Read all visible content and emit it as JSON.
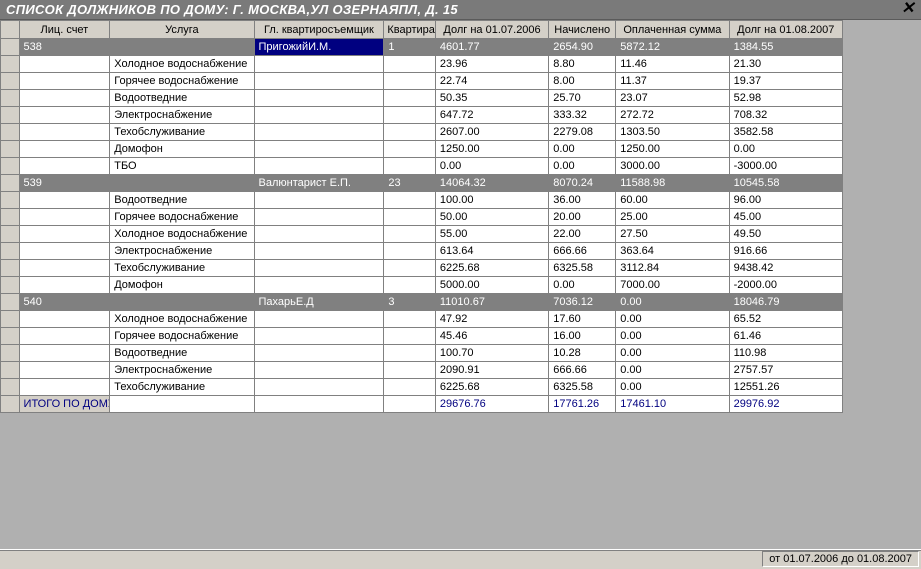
{
  "title": "СПИСОК ДОЛЖНИКОВ ПО ДОМУ: Г. МОСКВА,УЛ ОЗЕРНАЯПЛ, Д. 15",
  "close_glyph": "✕",
  "columns": {
    "acct": "Лиц. счет",
    "service": "Услуга",
    "tenant": "Гл. квартиросъемщик",
    "apt": "Квартира",
    "debt1": "Долг на 01.07.2006",
    "accrued": "Начислено",
    "paid": "Оплаченная сумма",
    "debt2": "Долг на 01.08.2007"
  },
  "rows": [
    {
      "type": "sum",
      "acct": "538",
      "service": "",
      "tenant": "ПригожийИ.М.",
      "tenant_selected": true,
      "apt": "1",
      "debt1": "4601.77",
      "accrued": "2654.90",
      "paid": "5872.12",
      "debt2": "1384.55"
    },
    {
      "type": "svc",
      "service": "Холодное водоснабжение",
      "debt1": "23.96",
      "accrued": "8.80",
      "paid": "11.46",
      "debt2": "21.30"
    },
    {
      "type": "svc",
      "service": "Горячее водоснабжение",
      "debt1": "22.74",
      "accrued": "8.00",
      "paid": "11.37",
      "debt2": "19.37"
    },
    {
      "type": "svc",
      "service": "Водоотведние",
      "debt1": "50.35",
      "accrued": "25.70",
      "paid": "23.07",
      "debt2": "52.98"
    },
    {
      "type": "svc",
      "service": "Электроснабжение",
      "debt1": "647.72",
      "accrued": "333.32",
      "paid": "272.72",
      "debt2": "708.32"
    },
    {
      "type": "svc",
      "service": "Техобслуживание",
      "debt1": "2607.00",
      "accrued": "2279.08",
      "paid": "1303.50",
      "debt2": "3582.58"
    },
    {
      "type": "svc",
      "service": "Домофон",
      "debt1": "1250.00",
      "accrued": "0.00",
      "paid": "1250.00",
      "debt2": "0.00"
    },
    {
      "type": "svc",
      "service": "ТБО",
      "debt1": "0.00",
      "accrued": "0.00",
      "paid": "3000.00",
      "debt2": "-3000.00"
    },
    {
      "type": "sum",
      "acct": "539",
      "service": "",
      "tenant": "Валюнтарист Е.П.",
      "apt": "23",
      "debt1": "14064.32",
      "accrued": "8070.24",
      "paid": "11588.98",
      "debt2": "10545.58"
    },
    {
      "type": "svc",
      "service": "Водоотведние",
      "debt1": "100.00",
      "accrued": "36.00",
      "paid": "60.00",
      "debt2": "96.00"
    },
    {
      "type": "svc",
      "service": "Горячее водоснабжение",
      "debt1": "50.00",
      "accrued": "20.00",
      "paid": "25.00",
      "debt2": "45.00"
    },
    {
      "type": "svc",
      "service": "Холодное водоснабжение",
      "debt1": "55.00",
      "accrued": "22.00",
      "paid": "27.50",
      "debt2": "49.50"
    },
    {
      "type": "svc",
      "service": "Электроснабжение",
      "debt1": "613.64",
      "accrued": "666.66",
      "paid": "363.64",
      "debt2": "916.66"
    },
    {
      "type": "svc",
      "service": "Техобслуживание",
      "debt1": "6225.68",
      "accrued": "6325.58",
      "paid": "3112.84",
      "debt2": "9438.42"
    },
    {
      "type": "svc",
      "service": "Домофон",
      "debt1": "5000.00",
      "accrued": "0.00",
      "paid": "7000.00",
      "debt2": "-2000.00"
    },
    {
      "type": "sum",
      "acct": "540",
      "service": "",
      "tenant": "ПахарьЕ.Д",
      "apt": "3",
      "debt1": "11010.67",
      "accrued": "7036.12",
      "paid": "0.00",
      "debt2": "18046.79"
    },
    {
      "type": "svc",
      "service": "Холодное водоснабжение",
      "debt1": "47.92",
      "accrued": "17.60",
      "paid": "0.00",
      "debt2": "65.52"
    },
    {
      "type": "svc",
      "service": "Горячее водоснабжение",
      "debt1": "45.46",
      "accrued": "16.00",
      "paid": "0.00",
      "debt2": "61.46"
    },
    {
      "type": "svc",
      "service": "Водоотведние",
      "debt1": "100.70",
      "accrued": "10.28",
      "paid": "0.00",
      "debt2": "110.98"
    },
    {
      "type": "svc",
      "service": "Электроснабжение",
      "debt1": "2090.91",
      "accrued": "666.66",
      "paid": "0.00",
      "debt2": "2757.57"
    },
    {
      "type": "svc",
      "service": "Техобслуживание",
      "debt1": "6225.68",
      "accrued": "6325.58",
      "paid": "0.00",
      "debt2": "12551.26"
    }
  ],
  "total": {
    "label": "ИТОГО ПО ДОМУ",
    "debt1": "29676.76",
    "accrued": "17761.26",
    "paid": "17461.10",
    "debt2": "29976.92"
  },
  "status": "от 01.07.2006 до 01.08.2007"
}
